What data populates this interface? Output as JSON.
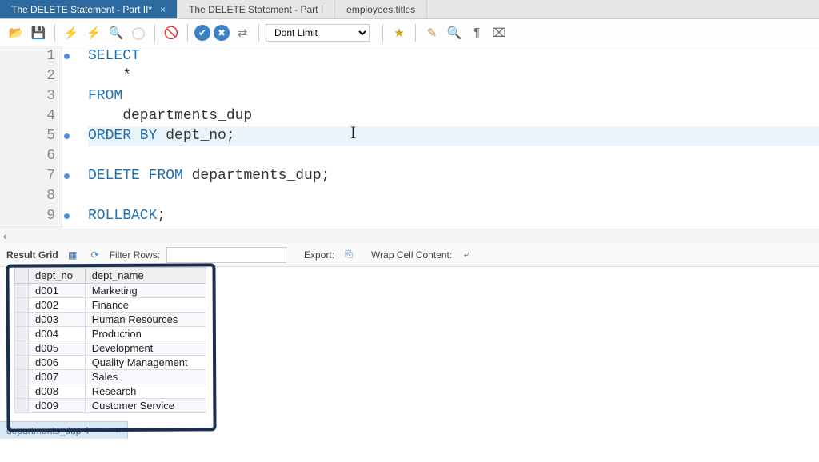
{
  "tabs": [
    {
      "label": "The DELETE Statement - Part II*",
      "active": true,
      "closeable": true
    },
    {
      "label": "The DELETE Statement - Part I",
      "active": false,
      "closeable": false
    },
    {
      "label": "employees.titles",
      "active": false,
      "closeable": false
    }
  ],
  "toolbar": {
    "limit_label": "Dont Limit",
    "icons": {
      "open": "folder-open-icon",
      "save": "save-icon",
      "exec": "lightning-icon",
      "exec_cur": "lightning-cursor-icon",
      "explain": "magnify-icon",
      "stop": "stop-icon",
      "no_exec": "no-entry-icon",
      "commit": "check-icon",
      "rollback": "x-icon",
      "autocommit": "toggle-icon",
      "fav": "star-icon",
      "beautify": "broom-icon",
      "find": "search-icon",
      "pilcrow": "pilcrow-icon",
      "shortcut": "keyboard-icon"
    }
  },
  "editor": {
    "lines": [
      {
        "n": 1,
        "marker": true,
        "tokens": [
          {
            "t": "SELECT",
            "c": "kw"
          }
        ]
      },
      {
        "n": 2,
        "marker": false,
        "tokens": [
          {
            "t": "    *",
            "c": "id"
          }
        ]
      },
      {
        "n": 3,
        "marker": false,
        "tokens": [
          {
            "t": "FROM",
            "c": "kw"
          }
        ]
      },
      {
        "n": 4,
        "marker": false,
        "tokens": [
          {
            "t": "    departments_dup",
            "c": "id"
          }
        ]
      },
      {
        "n": 5,
        "marker": true,
        "hl": true,
        "tokens": [
          {
            "t": "ORDER BY",
            "c": "kw"
          },
          {
            "t": " dept_no;",
            "c": "id"
          }
        ]
      },
      {
        "n": 6,
        "marker": false,
        "tokens": []
      },
      {
        "n": 7,
        "marker": true,
        "tokens": [
          {
            "t": "DELETE FROM",
            "c": "kw"
          },
          {
            "t": " departments_dup;",
            "c": "id"
          }
        ]
      },
      {
        "n": 8,
        "marker": false,
        "tokens": []
      },
      {
        "n": 9,
        "marker": true,
        "tokens": [
          {
            "t": "ROLLBACK",
            "c": "kw"
          },
          {
            "t": ";",
            "c": "id"
          }
        ]
      }
    ]
  },
  "result_toolbar": {
    "grid_label": "Result Grid",
    "filter_label": "Filter Rows:",
    "filter_value": "",
    "export_label": "Export:",
    "wrap_label": "Wrap Cell Content:"
  },
  "grid": {
    "columns": [
      "dept_no",
      "dept_name"
    ],
    "rows": [
      [
        "d001",
        "Marketing"
      ],
      [
        "d002",
        "Finance"
      ],
      [
        "d003",
        "Human Resources"
      ],
      [
        "d004",
        "Production"
      ],
      [
        "d005",
        "Development"
      ],
      [
        "d006",
        "Quality Management"
      ],
      [
        "d007",
        "Sales"
      ],
      [
        "d008",
        "Research"
      ],
      [
        "d009",
        "Customer Service"
      ]
    ]
  },
  "bottom_tab": {
    "label": "departments_dup 4"
  }
}
